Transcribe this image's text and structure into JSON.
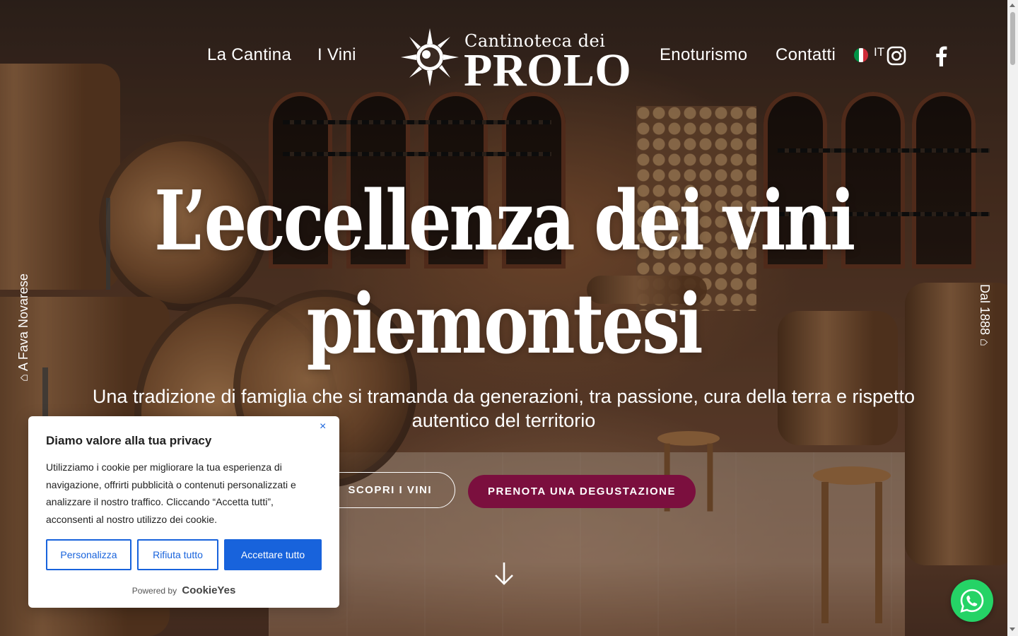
{
  "header": {
    "nav_left": [
      "La Cantina",
      "I Vini"
    ],
    "nav_right": [
      "Enoturismo",
      "Contatti"
    ],
    "logo": {
      "line1": "Cantinoteca dei",
      "line2": "PROLO"
    },
    "language": {
      "code": "IT",
      "flag_colors": [
        "#009246",
        "#ffffff",
        "#ce2b37"
      ]
    },
    "social": [
      "instagram-icon",
      "facebook-icon"
    ]
  },
  "side": {
    "left": "⌂ A Fava Novarese",
    "right": "Dal 1888 ⌂"
  },
  "hero": {
    "title_line1": "L’eccellenza dei vini",
    "title_line2": "piemontesi",
    "subtitle": "Una tradizione di famiglia che si tramanda da generazioni, tra passione, cura della terra e rispetto autentico del territorio",
    "btn_discover": "SCOPRI I VINI",
    "btn_book": "PRENOTA UNA DEGUSTAZIONE",
    "accent_color": "#7b0f3e"
  },
  "cookie": {
    "title": "Diamo valore alla tua privacy",
    "text": "Utilizziamo i cookie per migliorare la tua esperienza di navigazione, offrirti pubblicità o contenuti personalizzati e analizzare il nostro traffico. Cliccando “Accetta tutti”, acconsenti al nostro utilizzo dei cookie.",
    "btn_customize": "Personalizza",
    "btn_reject": "Rifiuta tutto",
    "btn_accept": "Accettare tutto",
    "powered_by": "Powered by",
    "brand": "CookieYes",
    "close": "×",
    "accent_color": "#1863dc"
  },
  "whatsapp": {
    "icon": "whatsapp-icon",
    "color": "#25d366"
  }
}
